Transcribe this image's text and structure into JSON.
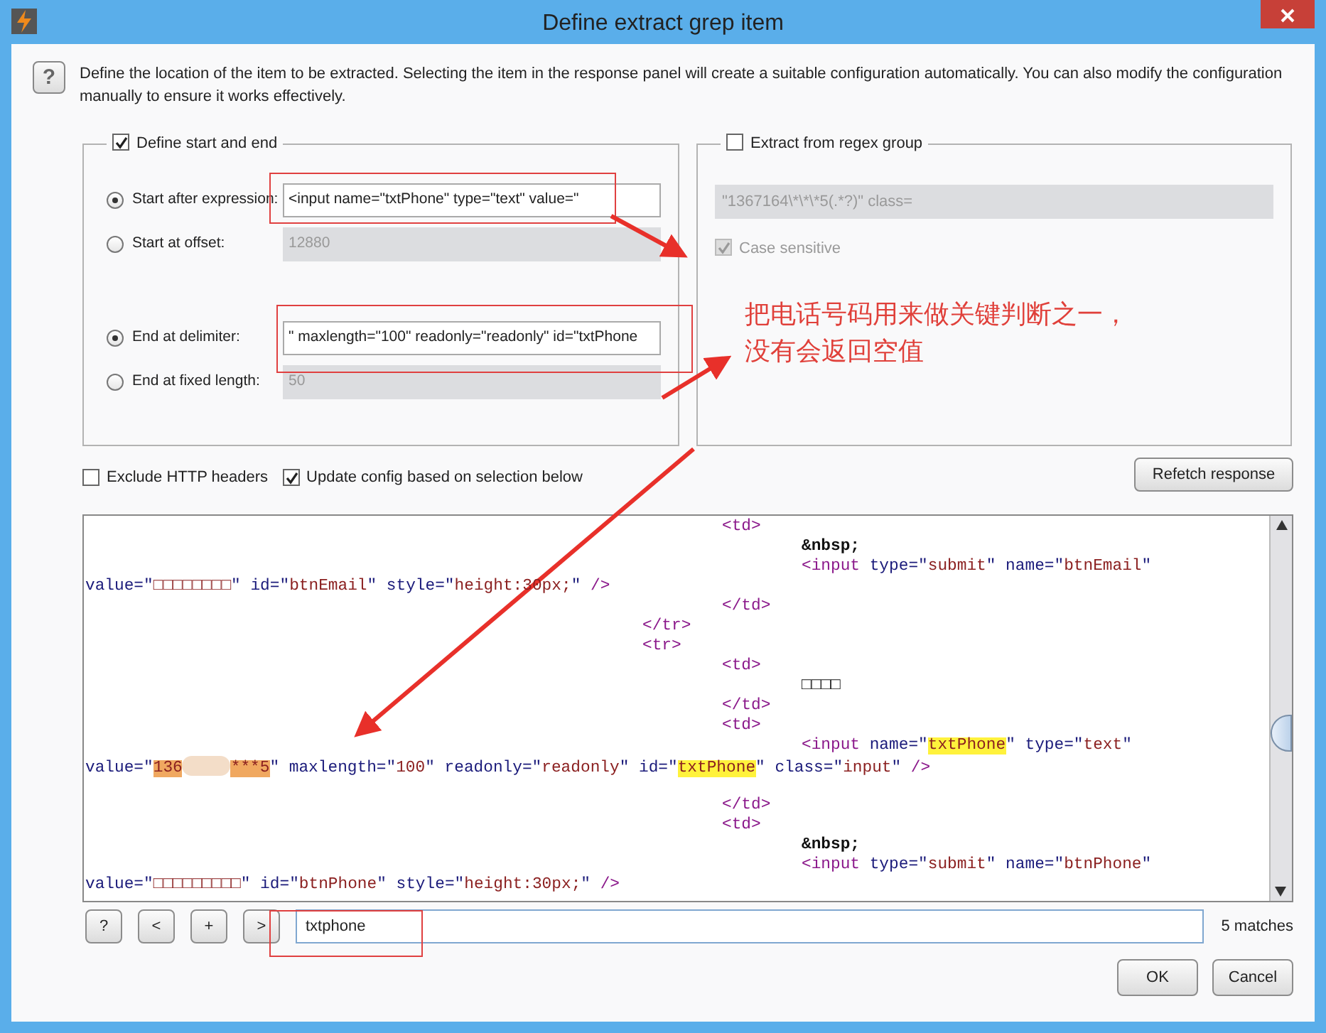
{
  "window": {
    "title": "Define extract grep item"
  },
  "help_button": "?",
  "description": "Define the location of the item to be extracted. Selecting the item in the response panel will create a suitable configuration automatically. You can also modify the configuration manually to ensure it works effectively.",
  "start_end": {
    "label": "Define start and end",
    "checked": true,
    "start_options": [
      {
        "label": "Start after expression:",
        "selected": true,
        "value": "<input name=\"txtPhone\" type=\"text\" value=\""
      },
      {
        "label": "Start at offset:",
        "selected": false,
        "value": "12880"
      }
    ],
    "end_options": [
      {
        "label": "End at delimiter:",
        "selected": true,
        "value": "\" maxlength=\"100\" readonly=\"readonly\" id=\"txtPhone"
      },
      {
        "label": "End at fixed length:",
        "selected": false,
        "value": "50"
      }
    ]
  },
  "regex": {
    "label": "Extract from regex group",
    "checked": false,
    "value": "\"1367164\\*\\*\\*5(.*?)\" class=",
    "case_sensitive": {
      "label": "Case sensitive",
      "checked": true
    }
  },
  "options": [
    {
      "label": "Exclude HTTP headers",
      "checked": false
    },
    {
      "label": "Update config based on selection below",
      "checked": true
    }
  ],
  "refetch_button": "Refetch response",
  "response": {
    "lines": [
      {
        "kind": "cell",
        "segments": [
          {
            "kind": "tag",
            "text": "<td>"
          }
        ]
      },
      {
        "kind": "content",
        "segments": [
          {
            "kind": "entity",
            "text": "&nbsp;"
          }
        ]
      },
      {
        "kind": "content",
        "segments": [
          {
            "kind": "tag",
            "text": "<input"
          },
          {
            "kind": "attr",
            "text": " type=\""
          },
          {
            "kind": "value",
            "text": "submit"
          },
          {
            "kind": "attr",
            "text": "\" name=\""
          },
          {
            "kind": "value",
            "text": "btnEmail"
          },
          {
            "kind": "attr",
            "text": "\""
          }
        ]
      },
      {
        "kind": "wrapped",
        "segments": [
          {
            "kind": "attr",
            "text": "value=\""
          },
          {
            "kind": "value",
            "text": "□□□□□□□□"
          },
          {
            "kind": "attr",
            "text": "\" id=\""
          },
          {
            "kind": "value",
            "text": "btnEmail"
          },
          {
            "kind": "attr",
            "text": "\" style=\""
          },
          {
            "kind": "value",
            "text": "height:30px;"
          },
          {
            "kind": "attr",
            "text": "\" "
          },
          {
            "kind": "tag",
            "text": "/>"
          }
        ]
      },
      {
        "kind": "cell",
        "segments": [
          {
            "kind": "tag",
            "text": "</td>"
          }
        ]
      },
      {
        "kind": "row",
        "segments": [
          {
            "kind": "tag",
            "text": "</tr>"
          }
        ]
      },
      {
        "kind": "row",
        "segments": [
          {
            "kind": "tag",
            "text": "<tr>"
          }
        ]
      },
      {
        "kind": "cell",
        "segments": [
          {
            "kind": "tag",
            "text": "<td>"
          }
        ]
      },
      {
        "kind": "content",
        "segments": [
          {
            "kind": "text",
            "text": "□□□□"
          }
        ]
      },
      {
        "kind": "cell",
        "segments": [
          {
            "kind": "tag",
            "text": "</td>"
          }
        ]
      },
      {
        "kind": "cell",
        "segments": [
          {
            "kind": "tag",
            "text": "<td>"
          }
        ]
      },
      {
        "kind": "content",
        "segments": [
          {
            "kind": "tag",
            "text": "<input"
          },
          {
            "kind": "attr",
            "text": " name=\""
          },
          {
            "kind": "match",
            "text": "txtPhone"
          },
          {
            "kind": "attr",
            "text": "\" type=\""
          },
          {
            "kind": "value",
            "text": "text"
          },
          {
            "kind": "attr",
            "text": "\""
          }
        ]
      },
      {
        "kind": "wrapped",
        "segments": [
          {
            "kind": "attr",
            "text": "value=\""
          },
          {
            "kind": "selection",
            "text": "136"
          },
          {
            "kind": "redacted"
          },
          {
            "kind": "selection",
            "text": "***5"
          },
          {
            "kind": "attr",
            "text": "\" maxlength=\""
          },
          {
            "kind": "value",
            "text": "100"
          },
          {
            "kind": "attr",
            "text": "\" readonly=\""
          },
          {
            "kind": "value",
            "text": "readonly"
          },
          {
            "kind": "attr",
            "text": "\" id=\""
          },
          {
            "kind": "match",
            "text": "txtPhone"
          },
          {
            "kind": "attr",
            "text": "\" class=\""
          },
          {
            "kind": "value",
            "text": "input"
          },
          {
            "kind": "attr",
            "text": "\" "
          },
          {
            "kind": "tag",
            "text": "/>"
          }
        ]
      },
      {
        "kind": "blank"
      },
      {
        "kind": "cell",
        "segments": [
          {
            "kind": "tag",
            "text": "</td>"
          }
        ]
      },
      {
        "kind": "cell",
        "segments": [
          {
            "kind": "tag",
            "text": "<td>"
          }
        ]
      },
      {
        "kind": "content",
        "segments": [
          {
            "kind": "entity",
            "text": "&nbsp;"
          }
        ]
      },
      {
        "kind": "content",
        "segments": [
          {
            "kind": "tag",
            "text": "<input"
          },
          {
            "kind": "attr",
            "text": " type=\""
          },
          {
            "kind": "value",
            "text": "submit"
          },
          {
            "kind": "attr",
            "text": "\" name=\""
          },
          {
            "kind": "value",
            "text": "btnPhone"
          },
          {
            "kind": "attr",
            "text": "\""
          }
        ]
      },
      {
        "kind": "wrapped",
        "segments": [
          {
            "kind": "attr",
            "text": "value=\""
          },
          {
            "kind": "value",
            "text": "□□□□□□□□□"
          },
          {
            "kind": "attr",
            "text": "\" id=\""
          },
          {
            "kind": "value",
            "text": "btnPhone"
          },
          {
            "kind": "attr",
            "text": "\" style=\""
          },
          {
            "kind": "value",
            "text": "height:30px;"
          },
          {
            "kind": "attr",
            "text": "\" "
          },
          {
            "kind": "tag",
            "text": "/>"
          }
        ]
      }
    ]
  },
  "search": {
    "buttons": [
      "?",
      "<",
      "+",
      ">"
    ],
    "value": "txtphone",
    "matches": "5 matches"
  },
  "buttons": [
    "OK",
    "Cancel"
  ],
  "annotation": {
    "text_lines": [
      "把电话号码用来做关键判断之一，",
      "没有会返回空值"
    ]
  }
}
